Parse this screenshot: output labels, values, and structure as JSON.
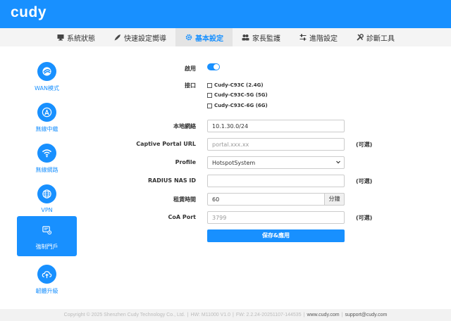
{
  "brand": {
    "logo": "cudy",
    "accent": "#1890ff"
  },
  "nav": [
    {
      "label": "系統狀態",
      "icon": "monitor-icon",
      "active": false
    },
    {
      "label": "快速設定嚮導",
      "icon": "rocket-icon",
      "active": false
    },
    {
      "label": "基本設定",
      "icon": "gear-icon",
      "active": true
    },
    {
      "label": "家長監護",
      "icon": "users-icon",
      "active": false
    },
    {
      "label": "進階設定",
      "icon": "sliders-icon",
      "active": false
    },
    {
      "label": "診斷工具",
      "icon": "tools-icon",
      "active": false
    }
  ],
  "sidebar": [
    {
      "label": "WAN模式",
      "icon": "wan-globe-icon",
      "active": false
    },
    {
      "label": "無線中繼",
      "icon": "repeater-antenna-icon",
      "active": false
    },
    {
      "label": "無線網路",
      "icon": "wifi-icon",
      "active": false
    },
    {
      "label": "VPN",
      "icon": "vpn-globe-icon",
      "active": false
    },
    {
      "label": "強制門戶",
      "icon": "captive-portal-icon",
      "active": true
    },
    {
      "label": "韌體升級",
      "icon": "cloud-upload-icon",
      "active": false
    }
  ],
  "form": {
    "enable_label": "啟用",
    "enabled": true,
    "interface_label": "接口",
    "interfaces": [
      {
        "label": "Cudy-C93C (2.4G)",
        "checked": false
      },
      {
        "label": "Cudy-C93C-5G (5G)",
        "checked": false
      },
      {
        "label": "Cudy-C93C-6G (6G)",
        "checked": false
      }
    ],
    "local_network_label": "本地網絡",
    "local_network_value": "10.1.30.0/24",
    "portal_url_label": "Captive Portal URL",
    "portal_url_placeholder": "portal.xxx.xx",
    "optional_text": "(可選)",
    "profile_label": "Profile",
    "profile_value": "HotspotSystem",
    "radius_label": "RADIUS NAS ID",
    "radius_value": "",
    "lease_label": "租賃時間",
    "lease_value": "60",
    "lease_unit": "分鐘",
    "coa_label": "CoA Port",
    "coa_placeholder": "3799",
    "save_label": "保存&應用"
  },
  "footer": {
    "copyright": "Copyright © 2025 Shenzhen Cudy Technology Co., Ltd.",
    "hw": "HW: M11000 V1.0",
    "fw": "FW: 2.2.24-20251107-144535",
    "website": "www.cudy.com",
    "email": "support@cudy.com"
  }
}
